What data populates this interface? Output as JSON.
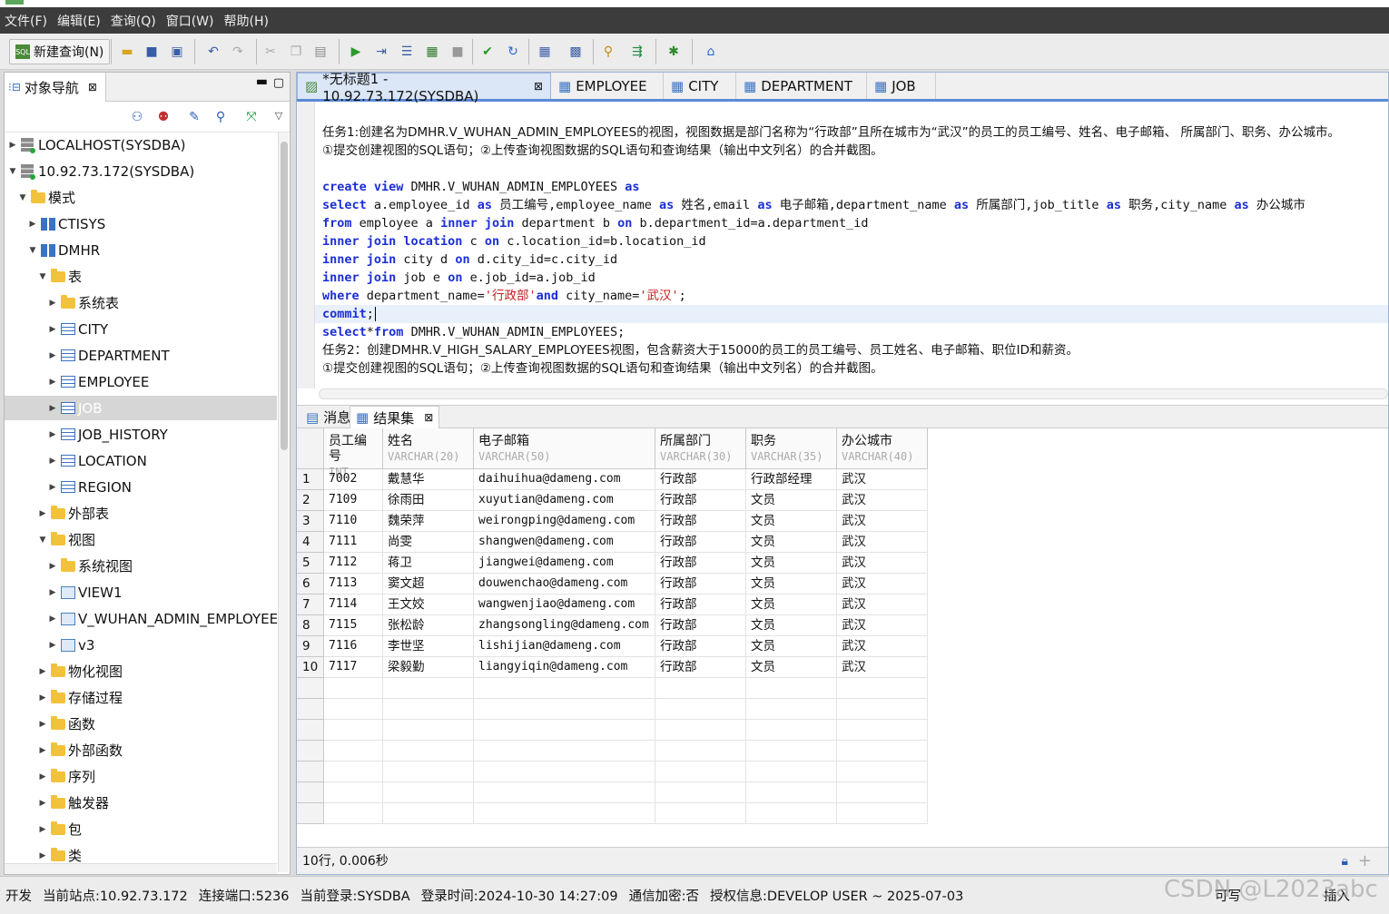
{
  "menu": [
    "文件(F)",
    "编辑(E)",
    "查询(Q)",
    "窗口(W)",
    "帮助(H)"
  ],
  "toolbar": {
    "new_query": "新建查询(N)"
  },
  "navigator": {
    "tab": "对象导航",
    "tree": [
      {
        "label": "LOCALHOST(SYSDBA)",
        "icon": "server-icon",
        "depth": 0,
        "open": false
      },
      {
        "label": "10.92.73.172(SYSDBA)",
        "icon": "server-icon",
        "depth": 0,
        "open": true
      },
      {
        "label": "模式",
        "icon": "folder-icon",
        "depth": 1,
        "open": true
      },
      {
        "label": "CTISYS",
        "icon": "schema-icon",
        "depth": 2,
        "open": false
      },
      {
        "label": "DMHR",
        "icon": "schema-icon",
        "depth": 2,
        "open": true
      },
      {
        "label": "表",
        "icon": "folder-icon",
        "depth": 3,
        "open": true
      },
      {
        "label": "系统表",
        "icon": "folder-icon",
        "depth": 4,
        "open": false
      },
      {
        "label": "CITY",
        "icon": "table-icon",
        "depth": 4,
        "open": false
      },
      {
        "label": "DEPARTMENT",
        "icon": "table-icon",
        "depth": 4,
        "open": false
      },
      {
        "label": "EMPLOYEE",
        "icon": "table-icon",
        "depth": 4,
        "open": false
      },
      {
        "label": "JOB",
        "icon": "table-icon",
        "depth": 4,
        "open": false,
        "selected": true
      },
      {
        "label": "JOB_HISTORY",
        "icon": "table-icon",
        "depth": 4,
        "open": false
      },
      {
        "label": "LOCATION",
        "icon": "table-icon",
        "depth": 4,
        "open": false
      },
      {
        "label": "REGION",
        "icon": "table-icon",
        "depth": 4,
        "open": false
      },
      {
        "label": "外部表",
        "icon": "folder-icon",
        "depth": 3,
        "open": false
      },
      {
        "label": "视图",
        "icon": "folder-icon",
        "depth": 3,
        "open": true
      },
      {
        "label": "系统视图",
        "icon": "folder-icon",
        "depth": 4,
        "open": false
      },
      {
        "label": "VIEW1",
        "icon": "view-icon",
        "depth": 4,
        "open": false
      },
      {
        "label": "V_WUHAN_ADMIN_EMPLOYEES",
        "icon": "view-icon",
        "depth": 4,
        "open": false
      },
      {
        "label": "v3",
        "icon": "view-icon",
        "depth": 4,
        "open": false
      },
      {
        "label": "物化视图",
        "icon": "folder-icon",
        "depth": 3,
        "open": false
      },
      {
        "label": "存储过程",
        "icon": "folder-icon",
        "depth": 3,
        "open": false
      },
      {
        "label": "函数",
        "icon": "folder-icon",
        "depth": 3,
        "open": false
      },
      {
        "label": "外部函数",
        "icon": "folder-icon",
        "depth": 3,
        "open": false
      },
      {
        "label": "序列",
        "icon": "folder-icon",
        "depth": 3,
        "open": false
      },
      {
        "label": "触发器",
        "icon": "folder-icon",
        "depth": 3,
        "open": false
      },
      {
        "label": "包",
        "icon": "folder-icon",
        "depth": 3,
        "open": false
      },
      {
        "label": "类",
        "icon": "folder-icon",
        "depth": 3,
        "open": false
      }
    ]
  },
  "editor": {
    "tabs": [
      {
        "label": "*无标题1 - 10.92.73.172(SYSDBA)",
        "icon": "sql-icon",
        "active": true
      },
      {
        "label": "EMPLOYEE",
        "icon": "table-icon"
      },
      {
        "label": "CITY",
        "icon": "table-icon"
      },
      {
        "label": "DEPARTMENT",
        "icon": "table-icon"
      },
      {
        "label": "JOB",
        "icon": "table-icon"
      }
    ],
    "lines": [
      [
        {
          "t": "任务1:创建名为DMHR.V_WUHAN_ADMIN_EMPLOYEES的视图，视图数据是部门名称为“行政部”且所在城市为“武汉”的员工的员工编号、姓名、电子邮箱、 所属部门、职务、办公城市。",
          "c": "zh"
        }
      ],
      [
        {
          "t": "①提交创建视图的SQL语句；②上传查询视图数据的SQL语句和查询结果（输出中文列名）的合并截图。",
          "c": "zh"
        }
      ],
      [],
      [
        {
          "t": "create view",
          "c": "kw"
        },
        {
          "t": " DMHR.V_WUHAN_ADMIN_EMPLOYEES "
        },
        {
          "t": "as",
          "c": "kw"
        }
      ],
      [
        {
          "t": "select",
          "c": "kw"
        },
        {
          "t": " a.employee_id "
        },
        {
          "t": "as",
          "c": "kw"
        },
        {
          "t": " 员工编号,employee_name "
        },
        {
          "t": "as",
          "c": "kw"
        },
        {
          "t": " 姓名,email "
        },
        {
          "t": "as",
          "c": "kw"
        },
        {
          "t": " 电子邮箱,department_name "
        },
        {
          "t": "as",
          "c": "kw"
        },
        {
          "t": " 所属部门,job_title "
        },
        {
          "t": "as",
          "c": "kw"
        },
        {
          "t": " 职务,city_name "
        },
        {
          "t": "as",
          "c": "kw"
        },
        {
          "t": " 办公城市"
        }
      ],
      [
        {
          "t": "from",
          "c": "kw"
        },
        {
          "t": " employee a "
        },
        {
          "t": "inner join",
          "c": "kw"
        },
        {
          "t": " department b "
        },
        {
          "t": "on",
          "c": "kw"
        },
        {
          "t": " b.department_id=a.department_id"
        }
      ],
      [
        {
          "t": "inner join location",
          "c": "kw"
        },
        {
          "t": " c "
        },
        {
          "t": "on",
          "c": "kw"
        },
        {
          "t": " c.location_id=b.location_id"
        }
      ],
      [
        {
          "t": "inner join",
          "c": "kw"
        },
        {
          "t": " city d "
        },
        {
          "t": "on",
          "c": "kw"
        },
        {
          "t": " d.city_id=c.city_id"
        }
      ],
      [
        {
          "t": "inner join",
          "c": "kw"
        },
        {
          "t": " job e "
        },
        {
          "t": "on",
          "c": "kw"
        },
        {
          "t": " e.job_id=a.job_id"
        }
      ],
      [
        {
          "t": "where",
          "c": "kw"
        },
        {
          "t": " department_name="
        },
        {
          "t": "'行政部'",
          "c": "st"
        },
        {
          "t": "and",
          "c": "kw"
        },
        {
          "t": " city_name="
        },
        {
          "t": "'武汉'",
          "c": "st"
        },
        {
          "t": ";"
        }
      ],
      [
        {
          "t": "commit",
          "c": "kw"
        },
        {
          "t": ";"
        }
      ],
      [
        {
          "t": "select",
          "c": "kw"
        },
        {
          "t": "*"
        },
        {
          "t": "from",
          "c": "kw"
        },
        {
          "t": " DMHR.V_WUHAN_ADMIN_EMPLOYEES;"
        }
      ],
      [
        {
          "t": "任务2：创建DMHR.V_HIGH_SALARY_EMPLOYEES视图，包含薪资大于15000的员工的员工编号、员工姓名、电子邮箱、职位ID和薪资。",
          "c": "zh"
        }
      ],
      [
        {
          "t": "①提交创建视图的SQL语句；②上传查询视图数据的SQL语句和查询结果（输出中文列名）的合并截图。",
          "c": "zh"
        }
      ]
    ]
  },
  "results": {
    "tabs": [
      "消息",
      "结果集"
    ],
    "columns": [
      {
        "name": "员工编号",
        "type": "INT"
      },
      {
        "name": "姓名",
        "type": "VARCHAR(20)"
      },
      {
        "name": "电子邮箱",
        "type": "VARCHAR(50)"
      },
      {
        "name": "所属部门",
        "type": "VARCHAR(30)"
      },
      {
        "name": "职务",
        "type": "VARCHAR(35)"
      },
      {
        "name": "办公城市",
        "type": "VARCHAR(40)"
      }
    ],
    "rows": [
      [
        "7002",
        "戴慧华",
        "daihuihua@dameng.com",
        "行政部",
        "行政部经理",
        "武汉"
      ],
      [
        "7109",
        "徐雨田",
        "xuyutian@dameng.com",
        "行政部",
        "文员",
        "武汉"
      ],
      [
        "7110",
        "魏荣萍",
        "weirongping@dameng.com",
        "行政部",
        "文员",
        "武汉"
      ],
      [
        "7111",
        "尚雯",
        "shangwen@dameng.com",
        "行政部",
        "文员",
        "武汉"
      ],
      [
        "7112",
        "蒋卫",
        "jiangwei@dameng.com",
        "行政部",
        "文员",
        "武汉"
      ],
      [
        "7113",
        "窦文超",
        "douwenchao@dameng.com",
        "行政部",
        "文员",
        "武汉"
      ],
      [
        "7114",
        "王文姣",
        "wangwenjiao@dameng.com",
        "行政部",
        "文员",
        "武汉"
      ],
      [
        "7115",
        "张松龄",
        "zhangsongling@dameng.com",
        "行政部",
        "文员",
        "武汉"
      ],
      [
        "7116",
        "李世坚",
        "lishijian@dameng.com",
        "行政部",
        "文员",
        "武汉"
      ],
      [
        "7117",
        "梁毅勤",
        "liangyiqin@dameng.com",
        "行政部",
        "文员",
        "武汉"
      ]
    ],
    "status": "10行, 0.006秒"
  },
  "statusbar": {
    "mode": "开发",
    "site": "当前站点:10.92.73.172",
    "port": "连接端口:5236",
    "login": "当前登录:SYSDBA",
    "time": "登录时间:2024-10-30 14:27:09",
    "enc": "通信加密:否",
    "license": "授权信息:DEVELOP USER ~ 2025-07-03",
    "writable": "可写",
    "insert": "插入"
  },
  "watermark": "CSDN @L2023abc"
}
